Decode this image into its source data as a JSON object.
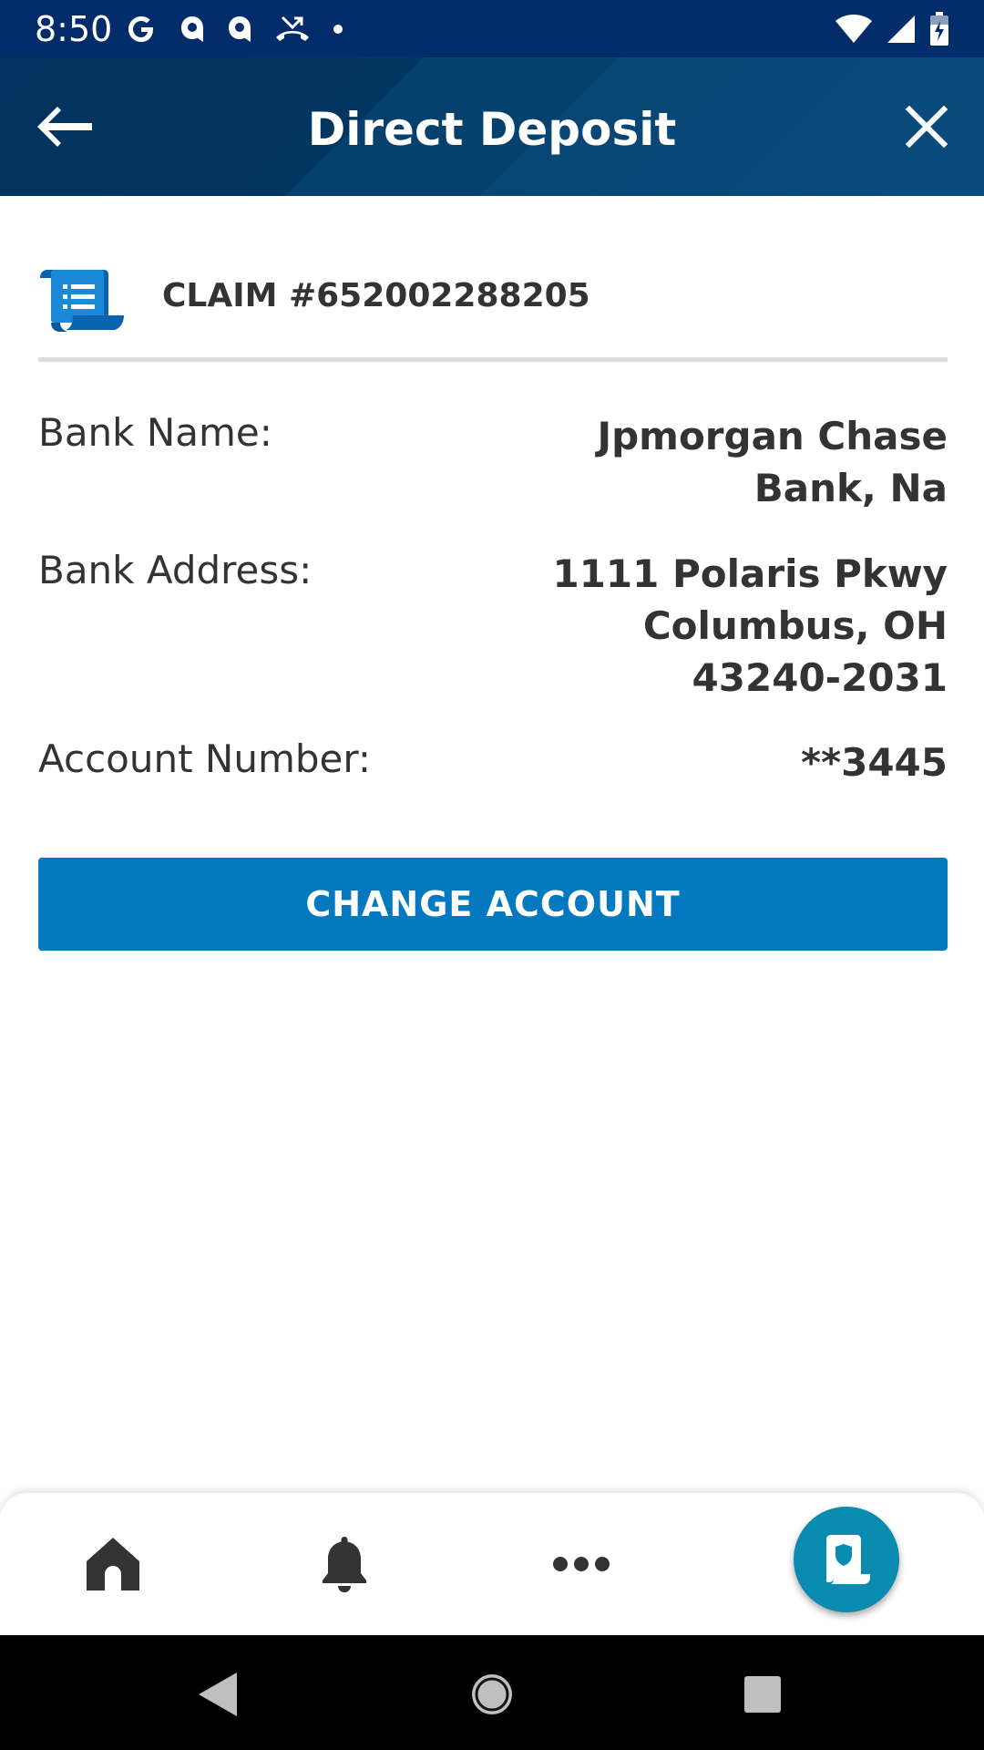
{
  "status_bar": {
    "time": "8:50",
    "left_icons": [
      "google-icon",
      "app-notification-icon",
      "app-notification-icon",
      "missed-call-icon",
      "dot-icon"
    ],
    "right_icons": [
      "wifi-icon",
      "cell-signal-icon",
      "battery-charging-icon"
    ]
  },
  "header": {
    "title": "Direct Deposit",
    "back_icon": "arrow-left-icon",
    "close_icon": "close-icon"
  },
  "claim": {
    "icon": "scroll-document-icon",
    "label": "CLAIM #652002288205"
  },
  "fields": [
    {
      "label": "Bank Name:",
      "value": "Jpmorgan Chase Bank, Na"
    },
    {
      "label": "Bank Address:",
      "value": "1111 Polaris Pkwy Columbus, OH 43240-2031"
    },
    {
      "label": "Account Number:",
      "value": "**3445"
    }
  ],
  "actions": {
    "change_account_label": "CHANGE ACCOUNT"
  },
  "bottom_nav": {
    "items": [
      "home-icon",
      "bell-icon",
      "more-horizontal-icon",
      "policy-shield-icon"
    ]
  },
  "system_nav": {
    "buttons": [
      "back-triangle-icon",
      "home-circle-icon",
      "recents-square-icon"
    ]
  },
  "colors": {
    "status_bar": "#022d6a",
    "header": "#033360",
    "button": "#0579bf",
    "fab": "#0a8bb0",
    "text": "#333333"
  }
}
